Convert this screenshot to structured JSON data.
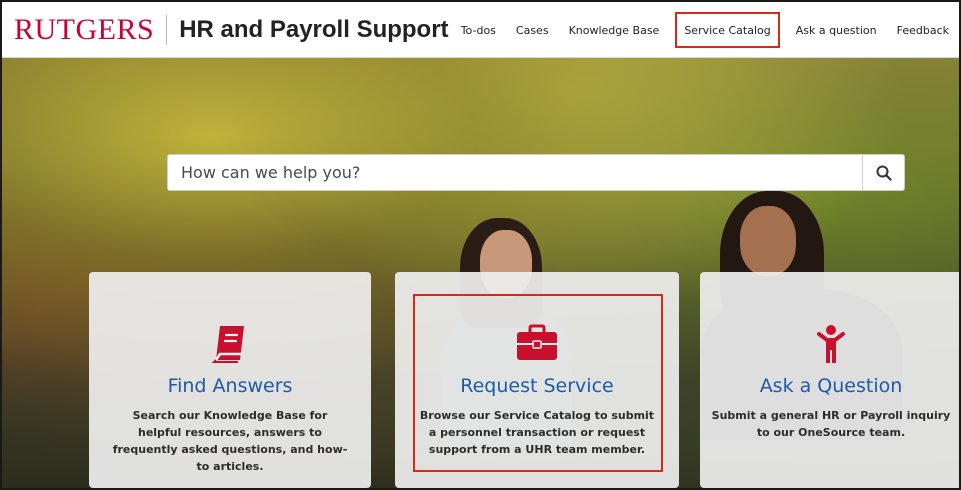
{
  "header": {
    "logo_text": "RUTGERS",
    "site_title": "HR and Payroll Support",
    "nav": [
      {
        "label": "To-dos"
      },
      {
        "label": "Cases"
      },
      {
        "label": "Knowledge Base"
      },
      {
        "label": "Service Catalog",
        "highlighted": true
      },
      {
        "label": "Ask a question"
      },
      {
        "label": "Feedback"
      }
    ]
  },
  "search": {
    "placeholder": "How can we help you?",
    "icon": "search-icon"
  },
  "cards": [
    {
      "icon": "book-icon",
      "title": "Find Answers",
      "description": "Search our Knowledge Base for helpful resources, answers to frequently asked questions, and how-to articles."
    },
    {
      "icon": "briefcase-icon",
      "title": "Request Service",
      "description": "Browse our Service Catalog to submit a personnel transaction or request support from a UHR team member.",
      "highlighted": true
    },
    {
      "icon": "person-icon",
      "title": "Ask a Question",
      "description": "Submit a general HR or Payroll inquiry to our OneSource team."
    }
  ],
  "colors": {
    "brand_red": "#cc0033",
    "link_blue": "#1e5aa8",
    "highlight_red": "#d22b1a",
    "icon_red": "#c8102e"
  }
}
